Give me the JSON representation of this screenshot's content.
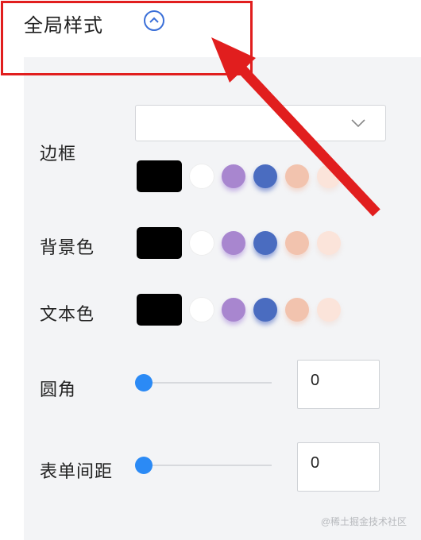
{
  "section": {
    "title": "全局样式",
    "collapse_icon": "chevron-up-icon"
  },
  "colors": {
    "accent": "#2b8af5",
    "highlight": "#e11e1e",
    "swatches": [
      "#000000",
      "#ffffff",
      "#a886cf",
      "#4a6cc0",
      "#f2c3ae",
      "#fbe4da"
    ]
  },
  "form": {
    "border": {
      "label": "边框",
      "select_value": ""
    },
    "background": {
      "label": "背景色"
    },
    "text_color": {
      "label": "文本色"
    },
    "radius": {
      "label": "圆角",
      "value": "0",
      "slider_fraction": 0
    },
    "spacing": {
      "label": "表单间距",
      "value": "0",
      "slider_fraction": 0
    }
  },
  "watermark": "@稀土掘金技术社区"
}
